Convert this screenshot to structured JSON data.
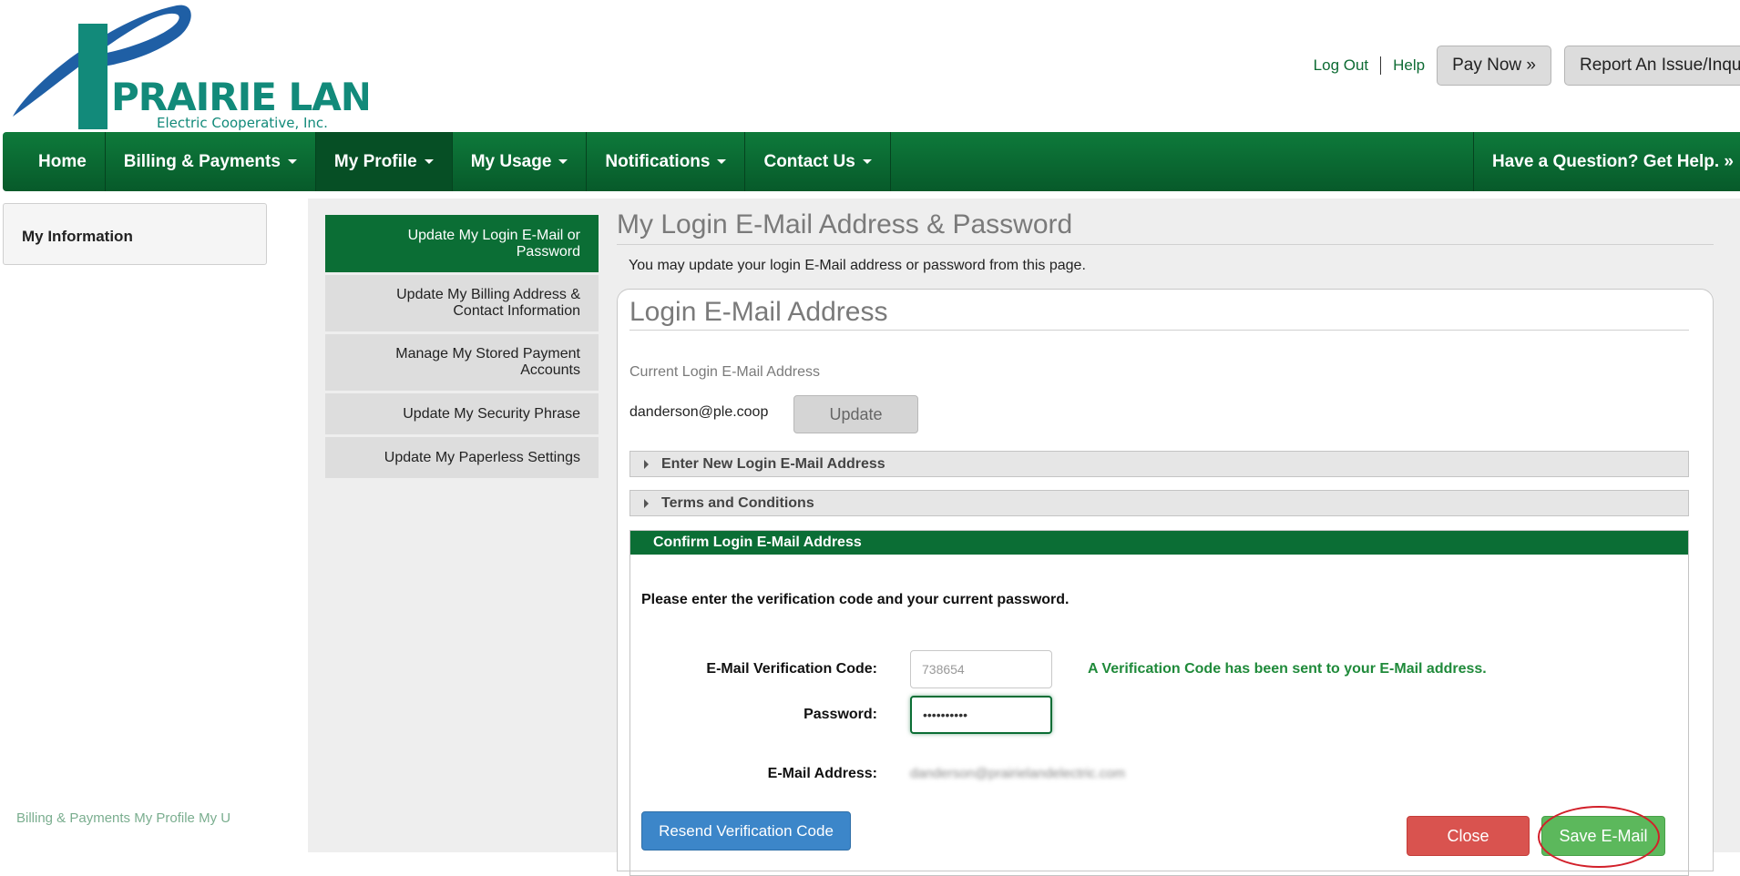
{
  "brand": {
    "logo_text": "PRAIRIE LAND",
    "logo_subtext": "Electric Cooperative, Inc."
  },
  "header": {
    "log_out": "Log Out",
    "help": "Help",
    "pay_now": "Pay Now »",
    "report_issue": "Report An Issue/Inqui"
  },
  "nav": {
    "home": "Home",
    "billing": "Billing & Payments",
    "profile": "My Profile",
    "usage": "My Usage",
    "notifications": "Notifications",
    "contact": "Contact Us",
    "help": "Have a Question? Get Help. »"
  },
  "sidebar": {
    "title": "My Information",
    "footer_ghost": "Billing & Payments   My Profile   My U"
  },
  "submenu": [
    {
      "label": "Update My Login E-Mail or Password"
    },
    {
      "label": "Update My Billing Address & Contact Information"
    },
    {
      "label": "Manage My Stored Payment Accounts"
    },
    {
      "label": "Update My Security Phrase"
    },
    {
      "label": "Update My Paperless Settings"
    }
  ],
  "main": {
    "title": "My Login E-Mail Address & Password",
    "description": "You may update your login E-Mail address or password from this page."
  },
  "login_email": {
    "title": "Login E-Mail Address",
    "current_label": "Current Login E-Mail Address",
    "current_value": "danderson@ple.coop",
    "update_button": "Update",
    "enter_new": "Enter New Login E-Mail Address",
    "terms": "Terms and Conditions"
  },
  "confirm": {
    "header": "Confirm Login E-Mail Address",
    "instruction": "Please enter the verification code and your current password.",
    "code_label": "E-Mail Verification Code:",
    "code_value": "738654",
    "code_message": "A Verification Code has been sent to your E-Mail address.",
    "password_label": "Password:",
    "password_value": "••••••••••",
    "email_label": "E-Mail Address:",
    "email_value": "danderson@prairielandelectric.com",
    "resend_button": "Resend Verification Code",
    "close_button": "Close",
    "save_button": "Save E-Mail"
  },
  "colors": {
    "brand_green": "#0b6e35",
    "logo_blue": "#1f5fa5",
    "logo_teal": "#128a7a",
    "close_red": "#d9534f",
    "save_green": "#5cb85c",
    "resend_blue": "#3c86c9",
    "highlight": "#d2202a"
  }
}
